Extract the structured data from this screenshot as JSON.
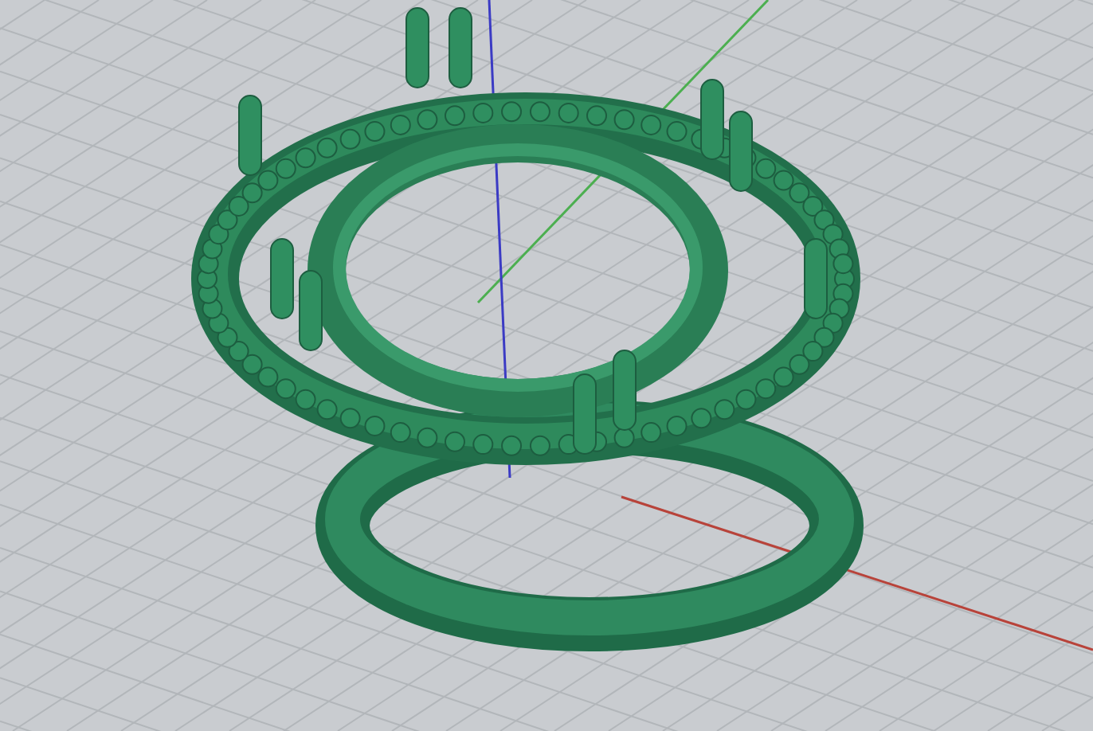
{
  "viewport": {
    "axes": [
      {
        "kind": "x",
        "color": "#b8433a"
      },
      {
        "kind": "y",
        "color": "#4caf50"
      },
      {
        "kind": "z",
        "color": "#3b3bc4"
      }
    ]
  }
}
